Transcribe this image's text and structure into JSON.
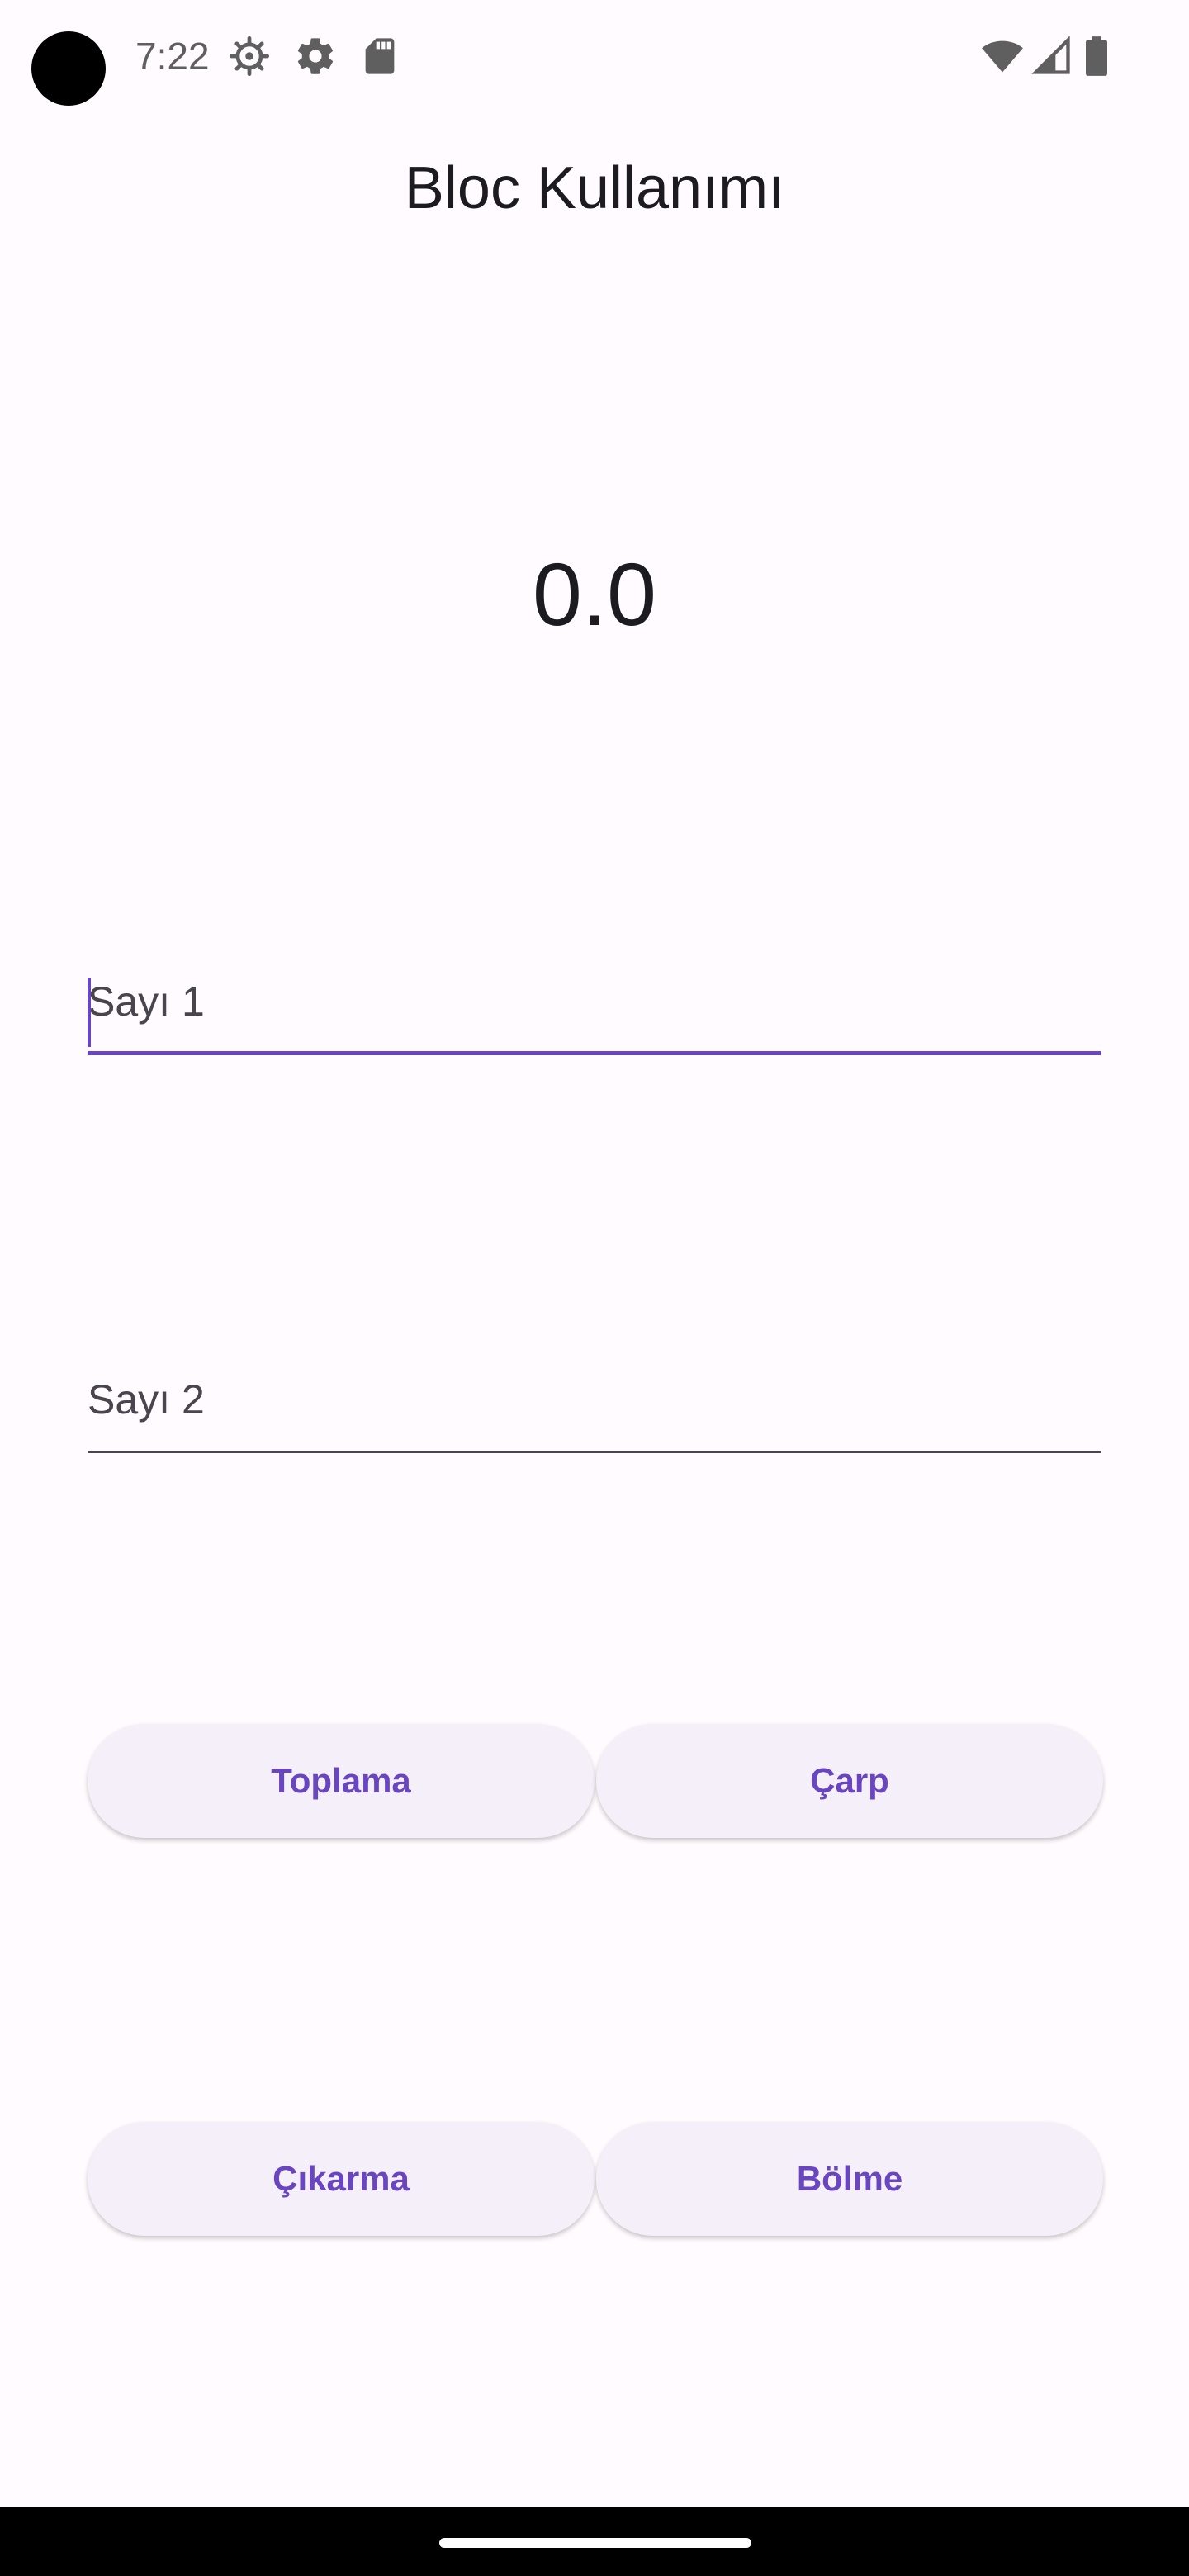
{
  "status_bar": {
    "time": "7:22",
    "icons": [
      "bug-settings-icon",
      "gear-icon",
      "sd-card-icon",
      "wifi-icon",
      "signal-icon",
      "battery-icon"
    ]
  },
  "app": {
    "title": "Bloc Kullanımı"
  },
  "result": {
    "value": "0.0"
  },
  "inputs": {
    "number1_label": "Sayı 1",
    "number2_label": "Sayı 2"
  },
  "buttons": {
    "add": "Toplama",
    "multiply": "Çarp",
    "subtract": "Çıkarma",
    "divide": "Bölme"
  },
  "colors": {
    "accent": "#6a45c0",
    "background": "#fffbfe",
    "button_bg": "#f4eff8"
  }
}
